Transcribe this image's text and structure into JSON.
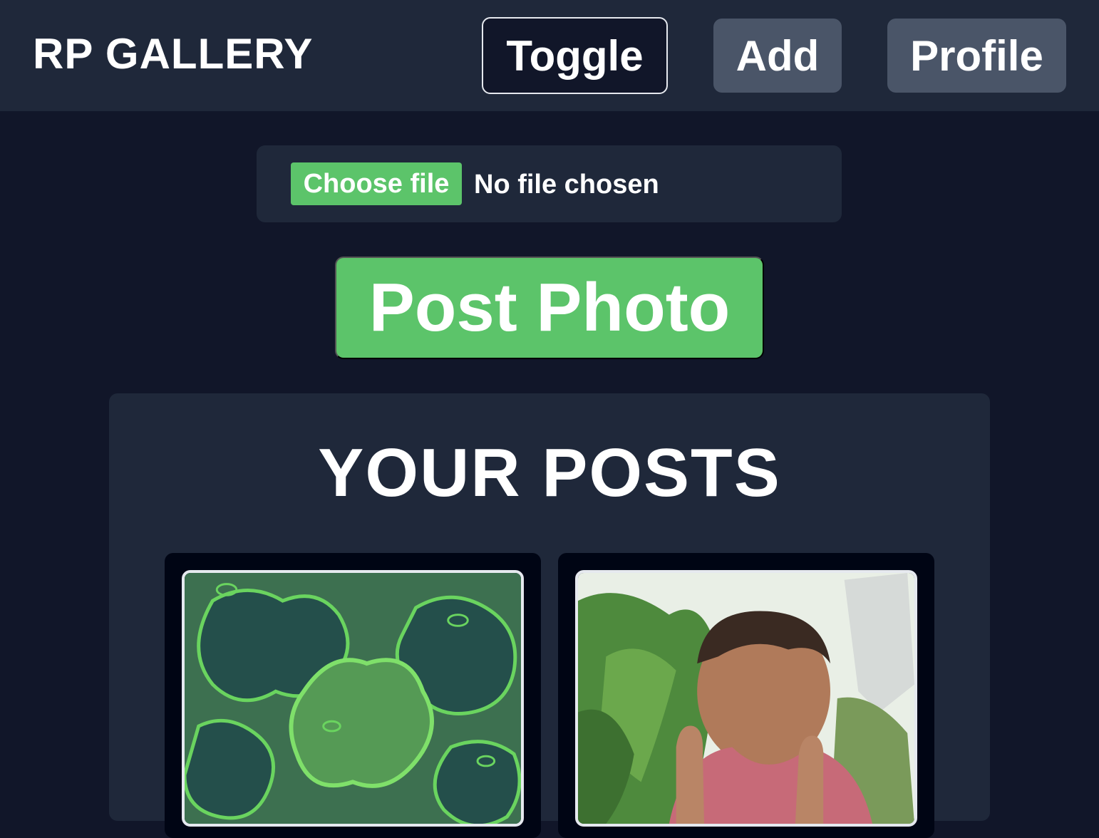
{
  "header": {
    "brand": "RP GALLERY",
    "toggle_label": "Toggle",
    "add_label": "Add",
    "profile_label": "Profile"
  },
  "upload": {
    "choose_label": "Choose file",
    "status": "No file chosen"
  },
  "post_button": "Post Photo",
  "posts": {
    "title": "YOUR POSTS",
    "items": [
      {
        "kind": "pattern-image"
      },
      {
        "kind": "selfie-photo"
      }
    ]
  },
  "colors": {
    "page_bg": "#111629",
    "nav_bg": "#1f283a",
    "panel_bg": "#1f283a",
    "accent_green": "#5cc46a",
    "nav_button_bg": "#4a5568",
    "card_bg": "#000514"
  }
}
